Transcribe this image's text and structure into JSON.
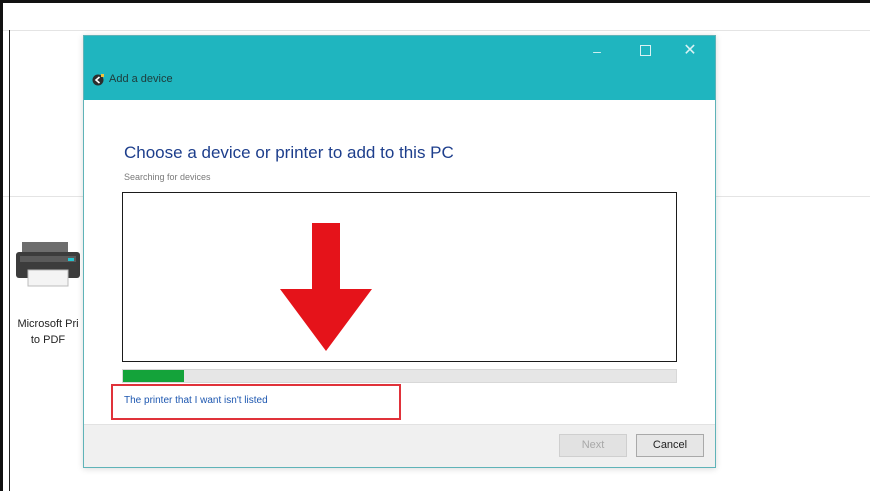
{
  "desktop": {
    "printer_label": "Microsoft Pri\nto PDF"
  },
  "dialog": {
    "title": "Add a device",
    "window_controls": {
      "minimize": "–",
      "close": "✕"
    },
    "heading": "Choose a device or printer to add to this PC",
    "status": "Searching for devices",
    "progress_percent": 11,
    "missing_printer_link": "The printer that I want isn't listed",
    "buttons": {
      "next": "Next",
      "cancel": "Cancel"
    }
  },
  "colors": {
    "titlebar": "#1fb5bf",
    "heading": "#1d3e8c",
    "progress": "#14a33a",
    "annotation_arrow": "#e5131a",
    "annotation_box": "#e0323a"
  },
  "icons": {
    "back": "back-arrow-icon",
    "desktop_printer": "printer-icon"
  }
}
